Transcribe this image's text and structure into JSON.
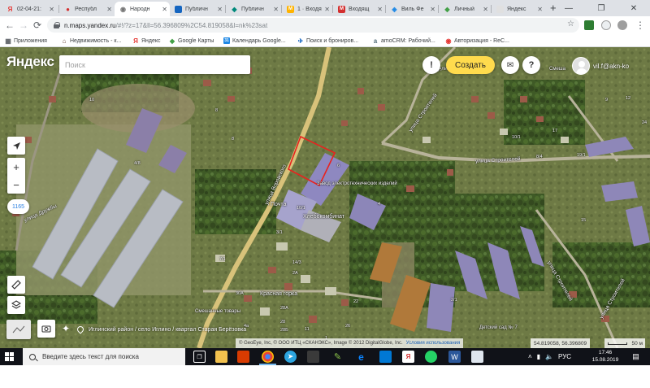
{
  "browser": {
    "tabs": [
      {
        "label": "02-04-21:",
        "favicon": "Я",
        "color": "#e53935"
      },
      {
        "label": "Республ",
        "favicon": "●",
        "color": "#d32f2f"
      },
      {
        "label": "Народн",
        "favicon": "◉",
        "color": "#fbc02d",
        "active": true
      },
      {
        "label": "Публичн",
        "favicon": "▬",
        "color": "#1565c0"
      },
      {
        "label": "Публичн",
        "favicon": "◆",
        "color": "#00897b"
      },
      {
        "label": "1 · Входя",
        "favicon": "M",
        "color": "#ffb300"
      },
      {
        "label": "Входящ",
        "favicon": "M",
        "color": "#d32f2f"
      },
      {
        "label": "Виль Фе",
        "favicon": "◈",
        "color": "#1e88e5"
      },
      {
        "label": "Личный",
        "favicon": "◆",
        "color": "#43a047"
      },
      {
        "label": "Яндекс",
        "favicon": "",
        "color": "#bdbdbd"
      }
    ],
    "url_host": "n.maps.yandex.ru",
    "url_rest": "/#!/?z=17&ll=56.396809%2C54.819058&l=nk%23sat",
    "bookmarks": [
      {
        "label": "Приложения",
        "color": "#5f6368",
        "glyph": "▦"
      },
      {
        "label": "Недвижимость - к...",
        "color": "#6d4c41",
        "glyph": "⌂"
      },
      {
        "label": "Яндекс",
        "color": "#e53935",
        "glyph": "Я"
      },
      {
        "label": "Google Карты",
        "color": "#43a047",
        "glyph": "◆"
      },
      {
        "label": "Календарь Google...",
        "color": "#1e88e5",
        "glyph": "31"
      },
      {
        "label": "Поиск и брониров...",
        "color": "#1565c0",
        "glyph": "✈"
      },
      {
        "label": "amoCRM: Рабочий...",
        "color": "#546e7a",
        "glyph": "a"
      },
      {
        "label": "Авторизация - ReC...",
        "color": "#e53935",
        "glyph": "◉"
      }
    ]
  },
  "map": {
    "logo": "Яндекс",
    "search_placeholder": "Поиск",
    "create_label": "Создать",
    "alert_glyph": "!",
    "help_glyph": "?",
    "chat_glyph": "✉",
    "user": "vil.f@akn-ko",
    "scale_badge": "1165",
    "zoom_in": "+",
    "zoom_out": "−",
    "address": "Иглинский район / село Иглино / квартал Старая Берёзовка",
    "copyright": "© GeoEye, Inc, © ООО ИТЦ «СКАНЭКС», Image © 2012 DigitalGlobe, Inc.",
    "terms_link": "Условия использования",
    "coordinates": "54.819058, 56.396809",
    "scale_text": "50 м",
    "labels": {
      "street_lenina": "Целинная улица",
      "street_stroitelei_1": "улица Строителей",
      "street_stroitelei_2": "улица Строителей",
      "street_vorovskogo": "улица Воровского",
      "street_druzhby": "улица Дружбы",
      "street_bottom_right": "улица Строителей",
      "street_right": "улица Строителей",
      "factory": "Завод электротехнических изделий",
      "bakery": "Хлебокомбинат",
      "post": "Почта",
      "store_krasnaya_gorka": "Красная горка",
      "store_mixed": "Смешанные товары",
      "kindergarten": "Детский сад № 7",
      "smeshannye_top": "Смеша"
    },
    "numbers": [
      "10",
      "8",
      "8",
      "4",
      "6",
      "10/1",
      "19/1",
      "8/4",
      "7/1",
      "17",
      "3/1",
      "14/3",
      "28А",
      "11",
      "2/1",
      "9",
      "28",
      "1",
      "15",
      "10/1",
      "12",
      "24",
      "4а",
      "2А",
      "30А",
      "26",
      "28Б",
      "4/8",
      "22"
    ]
  },
  "taskbar": {
    "search_placeholder": "Введите здесь текст для поиска",
    "time": "17:46",
    "date": "15.08.2019",
    "lang": "РУС"
  }
}
